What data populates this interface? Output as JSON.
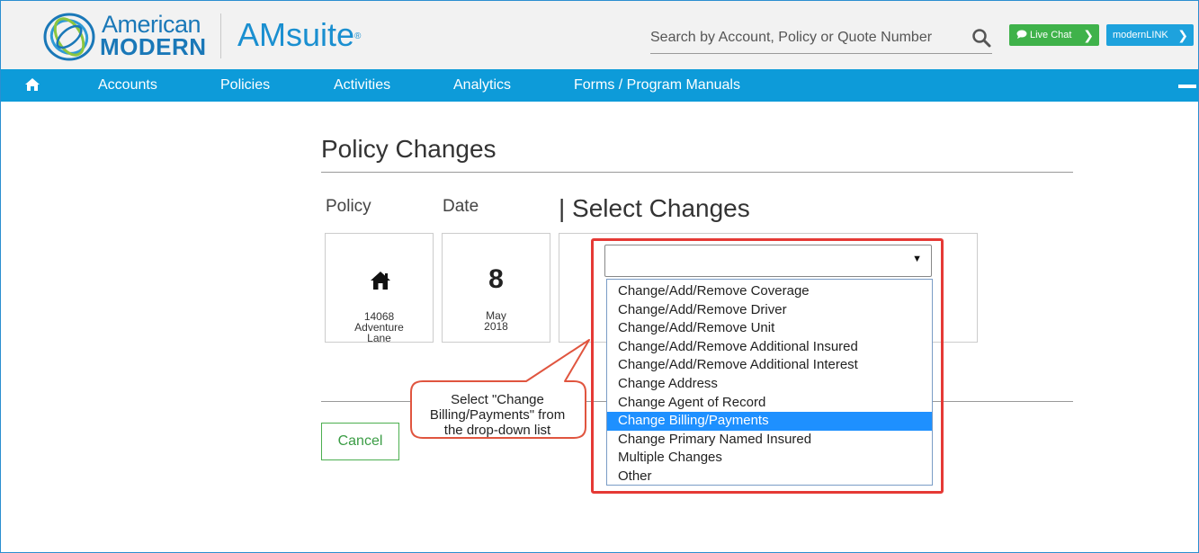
{
  "header": {
    "logo_american": "American",
    "logo_modern": "MODERN",
    "app_name": "AMsuite",
    "app_name_mark": "®",
    "search_placeholder": "Search by Account, Policy or Quote Number",
    "live_chat_label": "Live Chat",
    "modernlink_label": "modernLINK"
  },
  "nav": {
    "items": [
      {
        "label": "Accounts"
      },
      {
        "label": "Policies"
      },
      {
        "label": "Activities"
      },
      {
        "label": "Analytics"
      },
      {
        "label": "Forms / Program Manuals"
      }
    ]
  },
  "page": {
    "title": "Policy Changes",
    "policy_label": "Policy",
    "date_label": "Date",
    "select_changes_label": "| Select Changes",
    "policy_address": [
      "14068",
      "Adventure",
      "Lane"
    ],
    "date_day": "8",
    "date_month": "May",
    "date_year": "2018",
    "cancel_label": "Cancel"
  },
  "dropdown": {
    "selected_value": "",
    "options": [
      "Change/Add/Remove Coverage",
      "Change/Add/Remove Driver",
      "Change/Add/Remove Unit",
      "Change/Add/Remove Additional Insured",
      "Change/Add/Remove Additional Interest",
      "Change Address",
      "Change Agent of Record",
      "Change Billing/Payments",
      "Change Primary Named Insured",
      "Multiple Changes",
      "Other"
    ],
    "highlighted_option": "Change Billing/Payments"
  },
  "callout": {
    "lines": [
      "Select \"Change",
      "Billing/Payments\" from",
      "the drop-down list"
    ]
  },
  "colors": {
    "nav_blue": "#0d9bd9",
    "brand_blue": "#1a78b8",
    "live_chat_green": "#3fb24a",
    "highlight_red": "#e53935",
    "selection_blue": "#1e90ff"
  }
}
